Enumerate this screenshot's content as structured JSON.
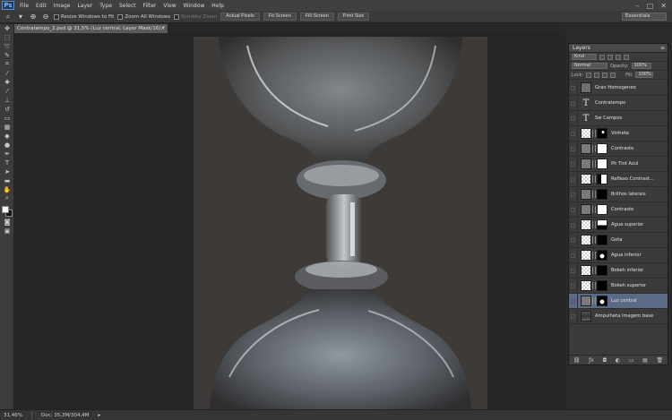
{
  "app": {
    "logo": "Ps",
    "menu": [
      "File",
      "Edit",
      "Image",
      "Layer",
      "Type",
      "Select",
      "Filter",
      "View",
      "Window",
      "Help"
    ],
    "window_controls": [
      "minimize-icon",
      "maximize-icon",
      "close-icon"
    ]
  },
  "options": {
    "resize_windows": "Resize Windows to Fit",
    "zoom_all": "Zoom All Windows",
    "scrubby_zoom": "Scrubby Zoom",
    "buttons": [
      "Actual Pixels",
      "Fit Screen",
      "Fill Screen",
      "Print Size"
    ],
    "workspace": "Essentials"
  },
  "document": {
    "tab_title": "Contratempo_2.psd @ 31,5% (Luz central, Layer Mask/16)",
    "tab_modified": "*"
  },
  "status": {
    "zoom": "31,46%",
    "doc_size": "Doc: 35,3M/304,4M"
  },
  "layers_panel": {
    "title": "Layers",
    "filter_kind": "Kind",
    "blend_mode": "Normal",
    "opacity_label": "Opacity:",
    "opacity_value": "100%",
    "lock_label": "Lock:",
    "fill_label": "Fill:",
    "fill_value": "100%",
    "layers": [
      {
        "name": "Gran Homogeneo",
        "thumb": "gray",
        "mask": "none",
        "active": false
      },
      {
        "name": "Contratempo",
        "thumb": "type",
        "mask": "none",
        "active": false
      },
      {
        "name": "Sw Campos",
        "thumb": "type",
        "mask": "none",
        "active": false
      },
      {
        "name": "Vinheta",
        "thumb": "check",
        "mask": "dot",
        "active": false
      },
      {
        "name": "Contraste",
        "thumb": "adj",
        "mask": "white",
        "active": false
      },
      {
        "name": "Ph Tint Azul",
        "thumb": "adj",
        "mask": "white",
        "active": false
      },
      {
        "name": "Reflexo Contrast...",
        "thumb": "check",
        "mask": "mixed-c",
        "active": false
      },
      {
        "name": "Brilhos laterais",
        "thumb": "adj",
        "mask": "black",
        "active": false
      },
      {
        "name": "Contraste",
        "thumb": "adj",
        "mask": "white",
        "active": false
      },
      {
        "name": "Agua superior",
        "thumb": "check",
        "mask": "mixed-a",
        "active": false
      },
      {
        "name": "Gota",
        "thumb": "check",
        "mask": "black",
        "active": false
      },
      {
        "name": "Agua inferior",
        "thumb": "check",
        "mask": "mixed-b",
        "active": false
      },
      {
        "name": "Bokeh inferior",
        "thumb": "check",
        "mask": "black",
        "active": false
      },
      {
        "name": "Bokeh superior",
        "thumb": "check",
        "mask": "black",
        "active": false
      },
      {
        "name": "Luz central",
        "thumb": "adj",
        "mask": "mixed-b",
        "active": true
      },
      {
        "name": "Ampulheta Imagem base",
        "thumb": "photo",
        "mask": "none",
        "active": false
      }
    ]
  }
}
